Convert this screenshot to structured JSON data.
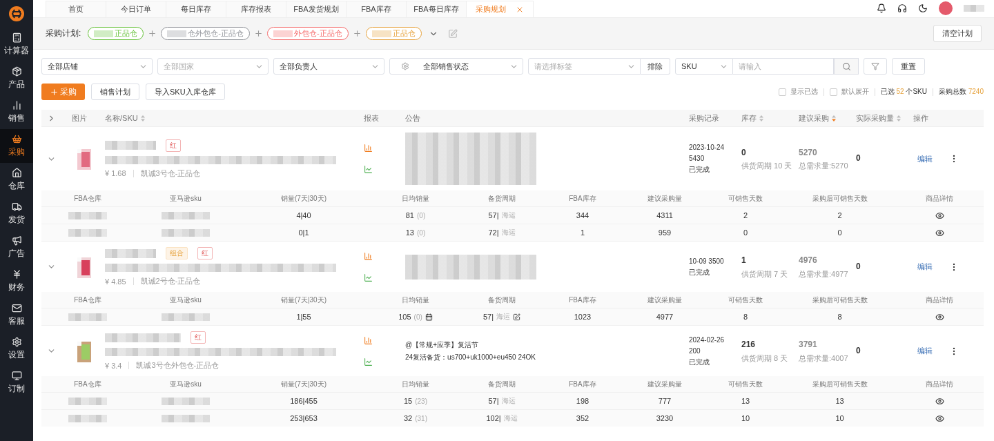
{
  "sidebar": {
    "items": [
      {
        "label": "计算器",
        "selected": false
      },
      {
        "label": "产品",
        "selected": false
      },
      {
        "label": "销售",
        "selected": false
      },
      {
        "label": "采购",
        "selected": true
      },
      {
        "label": "仓库",
        "selected": false
      },
      {
        "label": "发货",
        "selected": false
      },
      {
        "label": "广告",
        "selected": false
      },
      {
        "label": "财务",
        "selected": false
      },
      {
        "label": "客服",
        "selected": false
      },
      {
        "label": "设置",
        "selected": false
      },
      {
        "label": "订制",
        "selected": false
      }
    ]
  },
  "tabs": [
    {
      "label": "首页",
      "selected": false
    },
    {
      "label": "今日订单",
      "selected": false
    },
    {
      "label": "每日库存",
      "selected": false
    },
    {
      "label": "库存报表",
      "selected": false
    },
    {
      "label": "FBA发货规划",
      "selected": false
    },
    {
      "label": "FBA库存",
      "selected": false
    },
    {
      "label": "FBA每日库存",
      "selected": false
    },
    {
      "label": "采购规划",
      "selected": true
    }
  ],
  "plan_bar": {
    "label": "采购计划:",
    "chips": [
      {
        "text": "正品仓",
        "color": "#67c23a"
      },
      {
        "text": "仓外包仓-正品仓",
        "color": "#909399"
      },
      {
        "text": "外包仓-正品仓",
        "color": "#f56c6c"
      },
      {
        "text": "正品仓",
        "color": "#e6a23c"
      }
    ],
    "clear_button": "清空计划"
  },
  "filters": [
    {
      "kind": "select",
      "value": "全部店铺"
    },
    {
      "kind": "select",
      "placeholder": "全部国家"
    },
    {
      "kind": "select",
      "value": "全部负责人"
    },
    {
      "kind": "gear_select",
      "value": "全部销售状态"
    },
    {
      "kind": "tag_select",
      "placeholder": "请选择标签",
      "button": "排除"
    },
    {
      "kind": "search",
      "field": "SKU",
      "placeholder": "请输入"
    },
    {
      "kind": "filter_button"
    },
    {
      "kind": "button",
      "label": "重置"
    }
  ],
  "actions": {
    "primary": "采购",
    "buttons": [
      "销售计划",
      "导入SKU入库仓库"
    ],
    "options": [
      {
        "label": "显示已选",
        "checked": false
      },
      {
        "label": "默认展开",
        "checked": false
      }
    ],
    "selected_prefix": "已选",
    "selected_count": "52",
    "selected_suffix": "个SKU",
    "total_label": "采购总数",
    "total": "7240"
  },
  "table": {
    "columns": [
      {
        "label": "图片"
      },
      {
        "label": "名称/SKU",
        "sort_active": false
      },
      {
        "label": "报表"
      },
      {
        "label": "公告"
      },
      {
        "label": "采购记录"
      },
      {
        "label": "库存",
        "sort_active": false
      },
      {
        "label": "建议采购",
        "sort_active": true
      },
      {
        "label": "实际采购量",
        "sort_active": false
      },
      {
        "label": "操作"
      }
    ],
    "products": [
      {
        "expanded": true,
        "tags": [
          {
            "text": "红",
            "kind": "red"
          }
        ],
        "price": "¥ 1.68",
        "warehouse": "凯诚3号仓-正品仓",
        "record": [
          "2023-10-24",
          "5430",
          "已完成"
        ],
        "stock": "0",
        "supply": "供货周期 10 天",
        "suggested": "5270",
        "demand": "总需求量:5270",
        "actual": "0",
        "edit": "编辑",
        "sub_columns": [
          "FBA仓库",
          "亚马逊sku",
          "销量(7天|30天)",
          "日均销量",
          "备货周期",
          "FBA库存",
          "建议采购量",
          "可销售天数",
          "采购后可销售天数",
          "商品详情"
        ],
        "rows": [
          {
            "sales": "4|40",
            "daily": "81",
            "daily_note": "(0)",
            "calendar": false,
            "cycle": "57|",
            "ship": "海运",
            "editable": false,
            "fba": "344",
            "suggest": "4311",
            "days": "2",
            "after": "2"
          },
          {
            "sales": "0|1",
            "daily": "13",
            "daily_note": "(0)",
            "calendar": false,
            "cycle": "72|",
            "ship": "海运",
            "editable": false,
            "fba": "1",
            "suggest": "959",
            "days": "0",
            "after": "0"
          }
        ]
      },
      {
        "expanded": true,
        "tags": [
          {
            "text": "组合",
            "kind": "combo"
          },
          {
            "text": "红",
            "kind": "red"
          }
        ],
        "price": "¥ 4.85",
        "warehouse": "凯诚2号仓-正品仓",
        "record": [
          "10-09 3500",
          "已完成"
        ],
        "stock": "1",
        "supply": "供货周期 7 天",
        "suggested": "4976",
        "demand": "总需求量:4977",
        "actual": "0",
        "edit": "编辑",
        "sub_columns": [
          "FBA仓库",
          "亚马逊sku",
          "销量(7天|30天)",
          "日均销量",
          "备货周期",
          "FBA库存",
          "建议采购量",
          "可销售天数",
          "采购后可销售天数",
          "商品详情"
        ],
        "rows": [
          {
            "sales": "1|55",
            "daily": "105",
            "daily_note": "(0)",
            "calendar": true,
            "cycle": "57|",
            "ship": "海运",
            "editable": true,
            "fba": "1023",
            "suggest": "4977",
            "days": "8",
            "after": "8"
          }
        ]
      },
      {
        "expanded": true,
        "tags": [
          {
            "text": "红",
            "kind": "red"
          }
        ],
        "price": "¥ 3.4",
        "warehouse": "凯诚3号仓外包仓-正品仓",
        "announcement": [
          "@【常规+应季】复活节",
          "24复活备货：us700+uk1000+eu450 24OK"
        ],
        "record": [
          "2024-02-26",
          "200",
          "已完成"
        ],
        "stock": "216",
        "supply": "供货周期 8 天",
        "suggested": "3791",
        "demand": "总需求量:4007",
        "actual": "0",
        "edit": "编辑",
        "sub_columns": [
          "FBA仓库",
          "亚马逊sku",
          "销量(7天|30天)",
          "日均销量",
          "备货周期",
          "FBA库存",
          "建议采购量",
          "可销售天数",
          "采购后可销售天数",
          "商品详情"
        ],
        "rows": [
          {
            "sales": "186|455",
            "daily": "15",
            "daily_note": "(23)",
            "calendar": false,
            "cycle": "57|",
            "ship": "海运",
            "editable": false,
            "fba": "198",
            "suggest": "777",
            "days": "13",
            "after": "13"
          },
          {
            "sales": "253|653",
            "daily": "32",
            "daily_note": "(31)",
            "calendar": false,
            "cycle": "102|",
            "ship": "海运",
            "editable": false,
            "fba": "352",
            "suggest": "3230",
            "days": "10",
            "after": "10"
          }
        ]
      }
    ]
  }
}
